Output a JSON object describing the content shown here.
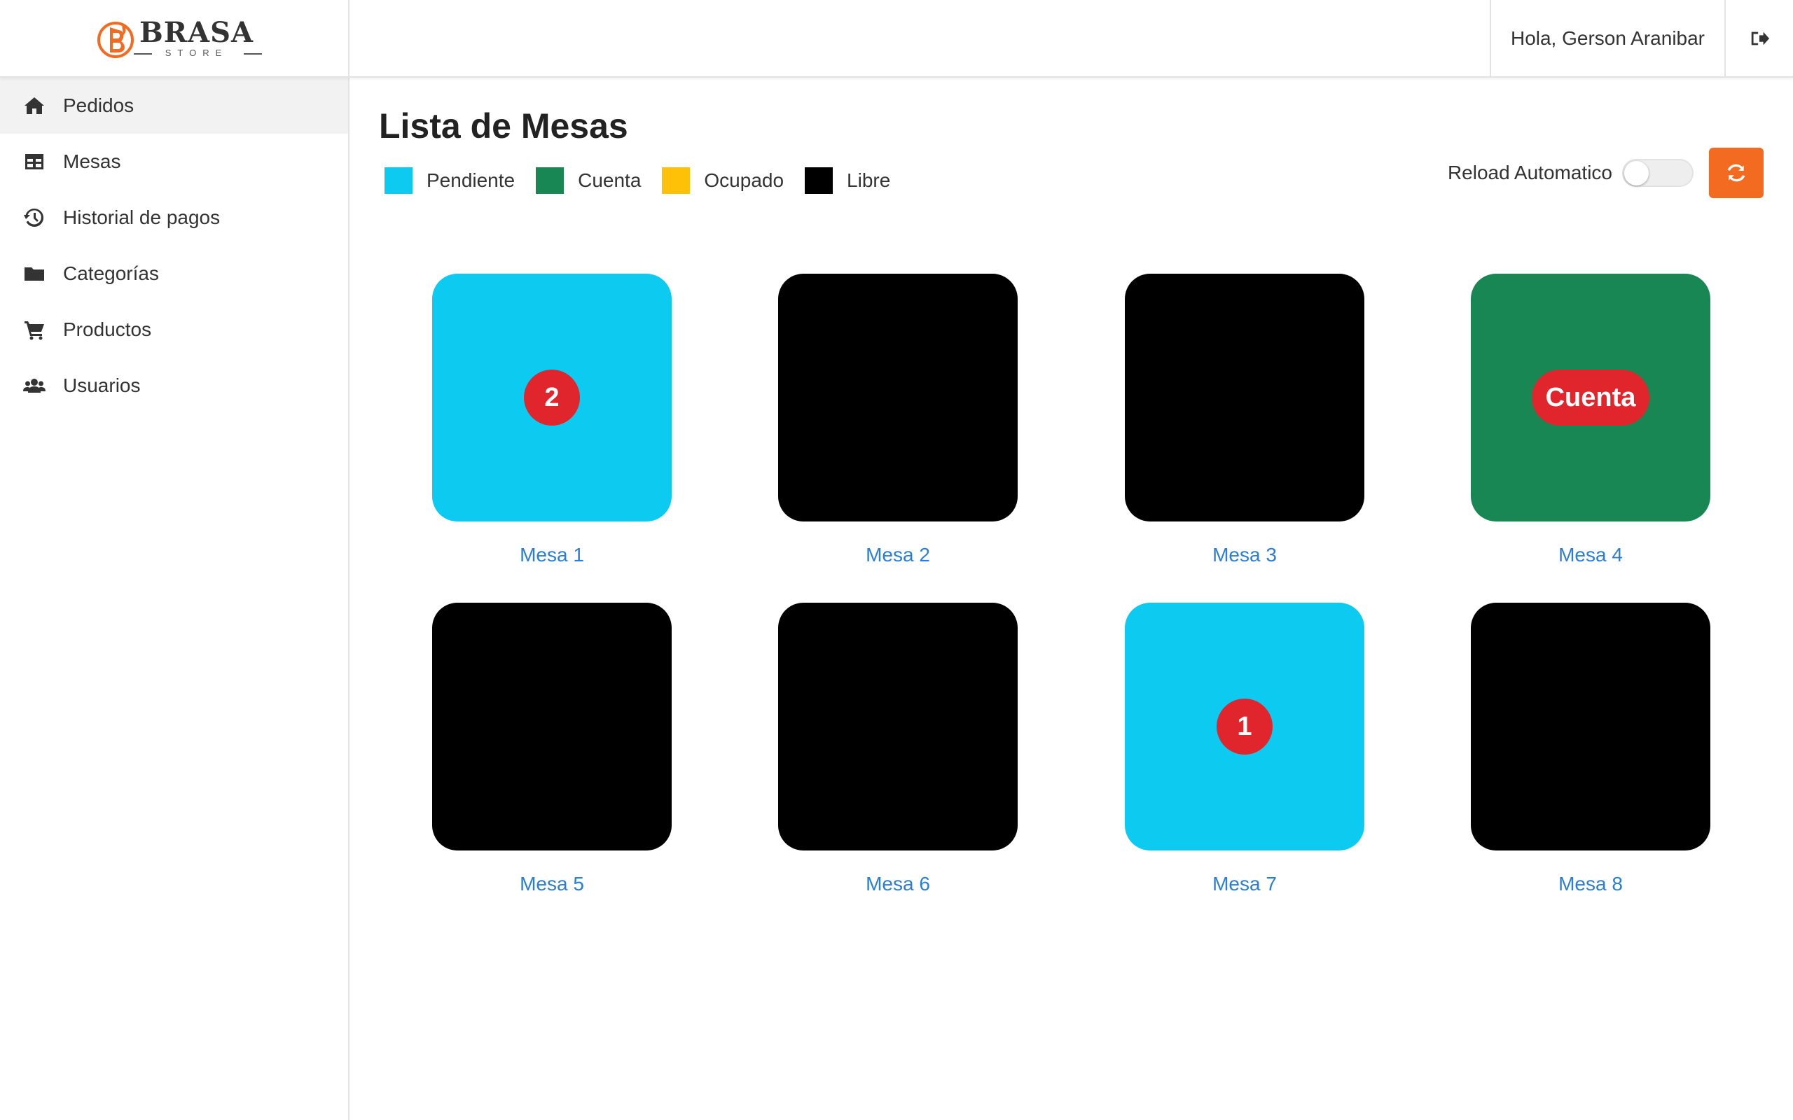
{
  "brand": {
    "name": "BRASA",
    "sub": "STORE",
    "accent": "#f26b21"
  },
  "header": {
    "greeting": "Hola, Gerson Aranibar"
  },
  "sidebar": {
    "items": [
      {
        "label": "Pedidos",
        "icon": "home-icon",
        "active": true
      },
      {
        "label": "Mesas",
        "icon": "table-icon",
        "active": false
      },
      {
        "label": "Historial de pagos",
        "icon": "history-icon",
        "active": false
      },
      {
        "label": "Categorías",
        "icon": "folder-icon",
        "active": false
      },
      {
        "label": "Productos",
        "icon": "cart-icon",
        "active": false
      },
      {
        "label": "Usuarios",
        "icon": "users-icon",
        "active": false
      }
    ]
  },
  "main": {
    "title": "Lista de Mesas",
    "legend": [
      {
        "label": "Pendiente",
        "color": "#0dcaf0"
      },
      {
        "label": "Cuenta",
        "color": "#198754"
      },
      {
        "label": "Ocupado",
        "color": "#ffc107"
      },
      {
        "label": "Libre",
        "color": "#000000"
      }
    ],
    "reload_label": "Reload Automatico",
    "reload_on": false,
    "refresh_color": "#f26b21"
  },
  "tables": [
    {
      "label": "Mesa 1",
      "status": "Pendiente",
      "color": "#0dcaf0",
      "badge": "2"
    },
    {
      "label": "Mesa 2",
      "status": "Libre",
      "color": "#000000",
      "badge": ""
    },
    {
      "label": "Mesa 3",
      "status": "Libre",
      "color": "#000000",
      "badge": ""
    },
    {
      "label": "Mesa 4",
      "status": "Cuenta",
      "color": "#198754",
      "badge": "Cuenta"
    },
    {
      "label": "Mesa 5",
      "status": "Libre",
      "color": "#000000",
      "badge": ""
    },
    {
      "label": "Mesa 6",
      "status": "Libre",
      "color": "#000000",
      "badge": ""
    },
    {
      "label": "Mesa 7",
      "status": "Pendiente",
      "color": "#0dcaf0",
      "badge": "1"
    },
    {
      "label": "Mesa 8",
      "status": "Libre",
      "color": "#000000",
      "badge": ""
    }
  ]
}
